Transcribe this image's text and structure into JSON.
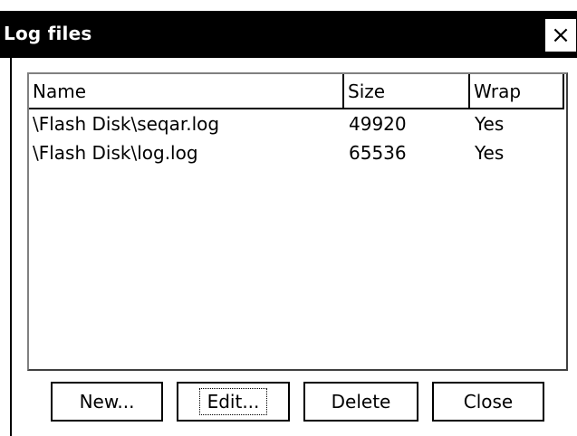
{
  "window": {
    "title": "Log files",
    "close_label": "×"
  },
  "list": {
    "columns": [
      "Name",
      "Size",
      "Wrap"
    ],
    "rows": [
      {
        "name": "\\Flash Disk\\seqar.log",
        "size": "49920",
        "wrap": "Yes"
      },
      {
        "name": "\\Flash Disk\\log.log",
        "size": "65536",
        "wrap": "Yes"
      }
    ]
  },
  "buttons": {
    "new_label": "New...",
    "edit_label": "Edit...",
    "delete_label": "Delete",
    "close_label": "Close"
  }
}
